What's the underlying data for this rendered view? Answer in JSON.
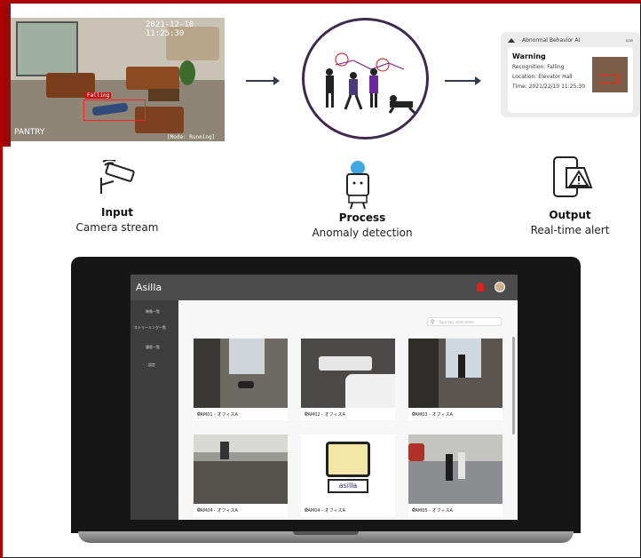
{
  "input": {
    "title": "Input",
    "subtitle": "Camera stream",
    "cctv": {
      "timestamp": "2021-12-10 11:25:30",
      "camera_name": "PANTRY",
      "mode": "[Mode: Running]",
      "detection_label": "Falling"
    }
  },
  "process": {
    "title": "Process",
    "subtitle": "Anomaly detection"
  },
  "output": {
    "title": "Output",
    "subtitle": "Real-time alert",
    "alert": {
      "app": "Abnormal Behavior AI",
      "time_ago": "now",
      "heading": "Warning",
      "recognition": "Recognition: Falling",
      "location": "Location: Elevator Hall",
      "time": "Time: 2021/22/10 11:25:30"
    }
  },
  "dashboard": {
    "app_title": "Asilla",
    "sidebar": [
      "映像一覧",
      "ストリーミング一覧",
      "履歴一覧",
      "設定"
    ],
    "search_placeholder": "Type key comments",
    "cameras": [
      {
        "name": "CAM01 - オフィスA"
      },
      {
        "name": "CAM02 - オフィスA"
      },
      {
        "name": "CAM03 - オフィスA"
      },
      {
        "name": "CAM04 - オフィスA"
      },
      {
        "name": "CAM04 - オフィスA",
        "logo_text": "asilla"
      },
      {
        "name": "CAM05 - オフィスA"
      }
    ]
  },
  "colors": {
    "accent": "#3d2a4d",
    "alert_red": "#d01010",
    "frame_red": "#9b0a0a"
  }
}
